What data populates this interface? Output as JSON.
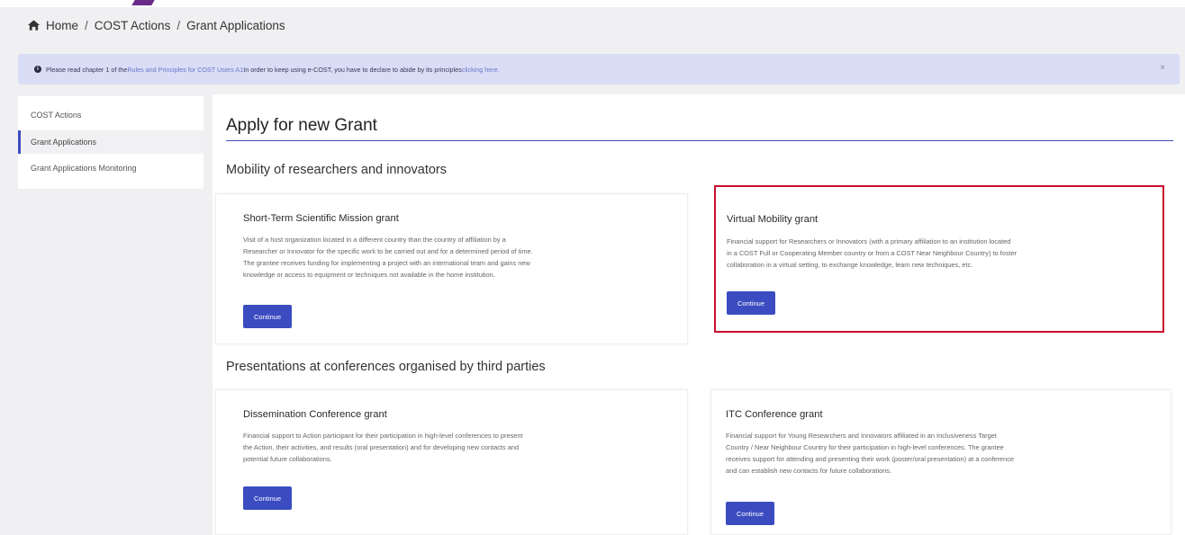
{
  "breadcrumb": {
    "items": [
      "Home",
      "COST Actions",
      "Grant Applications"
    ],
    "separator": "/"
  },
  "notice": {
    "icon": "info-icon",
    "text_1": "Please read chapter 1 of the ",
    "link_1": "Rules and Principles for COST Users A1",
    "text_2": " In order to keep using e-COST, you have to declare to abide by its principles ",
    "link_2": "clicking here.",
    "close": "×"
  },
  "sidebar": {
    "items": [
      {
        "label": "COST Actions",
        "active": false
      },
      {
        "label": "Grant Applications",
        "active": true
      },
      {
        "label": "Grant Applications Monitoring",
        "active": false
      }
    ]
  },
  "main": {
    "title": "Apply for new Grant",
    "sections": [
      {
        "title": "Mobility of researchers and innovators",
        "cards": [
          {
            "title": "Short-Term Scientific Mission grant",
            "lines": [
              "Visit of a host organization located in a different country than the country of affiliation by a",
              "Researcher or Innovator for the specific work to be carried out and for a determined period of time.",
              "The grantee receives funding for implementing a project with an international team and gains new",
              "knowledge or access to equipment or techniques not available in the home institution."
            ],
            "button": "Continue"
          },
          {
            "title": "Virtual Mobility grant",
            "lines": [
              "Financial support for Researchers or Innovators (with a primary affiliation to an institution located",
              "in a COST Full or Cooperating Member country or from a COST Near Neighbour Country) to foster",
              "collaboration in a virtual setting, to exchange knowledge, learn new techniques, etc."
            ],
            "button": "Continue"
          }
        ]
      },
      {
        "title": "Presentations at conferences organised by third parties",
        "cards": [
          {
            "title": "Dissemination Conference grant",
            "lines": [
              "Financial support to Action participant for their participation in high-level conferences to present",
              "the Action, their activities, and results (oral presentation) and for developing new contacts and",
              "potential future collaborations."
            ],
            "button": "Continue"
          },
          {
            "title": "ITC Conference grant",
            "lines": [
              "Financial support for Young Researchers and Innovators affiliated in an Inclusiveness Target",
              "Country / Near Neighbour Country for their participation in high-level conferences. The grantee",
              "receives support for attending and presenting their work (poster/oral presentation) at a conference",
              "and can establish new contacts for future collaborations."
            ],
            "button": "Continue"
          }
        ]
      }
    ]
  },
  "colors": {
    "primary": "#3b4cc0",
    "highlight": "#c8102e",
    "notice_bg": "#d9ddf6"
  }
}
